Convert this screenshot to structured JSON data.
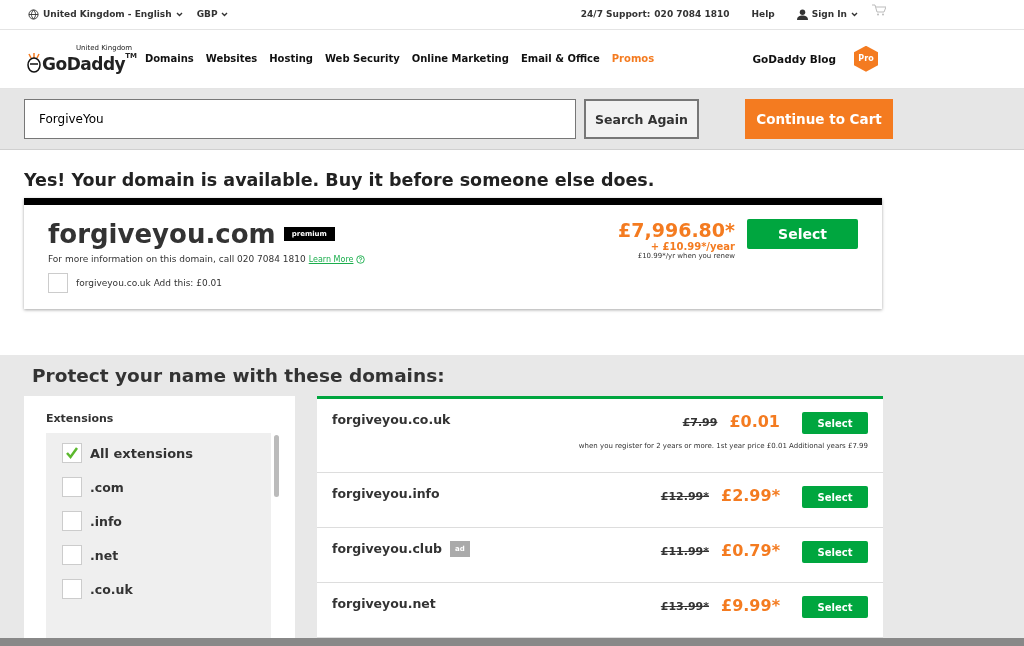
{
  "top_bar": {
    "language": "United Kingdom - English",
    "currency": "GBP",
    "support_label": "24/7 Support:",
    "support_phone": "020 7084 1810",
    "help": "Help",
    "sign_in": "Sign In"
  },
  "nav": {
    "logo": "GoDaddy",
    "logo_tm": "TM",
    "logo_region": "United Kingdom",
    "items": [
      {
        "label": "Domains",
        "promo": false
      },
      {
        "label": "Websites",
        "promo": false
      },
      {
        "label": "Hosting",
        "promo": false
      },
      {
        "label": "Web Security",
        "promo": false
      },
      {
        "label": "Online Marketing",
        "promo": false
      },
      {
        "label": "Email & Office",
        "promo": false
      },
      {
        "label": "Promos",
        "promo": true
      }
    ],
    "blog": "GoDaddy Blog",
    "pro": "Pro"
  },
  "search": {
    "value": "ForgiveYou",
    "search_button": "Search Again",
    "cart_button": "Continue to Cart"
  },
  "result": {
    "heading": "Yes! Your domain is available. Buy it before someone else does.",
    "domain": "forgiveyou.com",
    "badge": "premium",
    "info": "For more information on this domain, call 020 7084 1810",
    "learn_more": "Learn More",
    "addon": {
      "label": "forgiveyou.co.uk Add this: £0.01",
      "checked": false
    },
    "price": "£7,996.80*",
    "yearly": "+ £10.99*/year",
    "renew": "£10.99*/yr when you renew",
    "select": "Select"
  },
  "protect": {
    "heading": "Protect your name with these domains:",
    "filters_title": "Extensions",
    "filters": [
      {
        "label": "All extensions",
        "checked": true
      },
      {
        "label": ".com",
        "checked": false
      },
      {
        "label": ".info",
        "checked": false
      },
      {
        "label": ".net",
        "checked": false
      },
      {
        "label": ".co.uk",
        "checked": false
      }
    ],
    "domains": [
      {
        "name": "forgiveyou.co.uk",
        "old_price": "£7.99",
        "price": "£0.01",
        "note": "when you register for 2 years or more. 1st year price £0.01 Additional years £7.99",
        "select": "Select"
      },
      {
        "name": "forgiveyou.info",
        "old_price": "£12.99*",
        "price": "£2.99*",
        "select": "Select"
      },
      {
        "name": "forgiveyou.club",
        "tag": "ad",
        "old_price": "£11.99*",
        "price": "£0.79*",
        "select": "Select"
      },
      {
        "name": "forgiveyou.net",
        "old_price": "£13.99*",
        "price": "£9.99*",
        "select": "Select"
      }
    ]
  }
}
